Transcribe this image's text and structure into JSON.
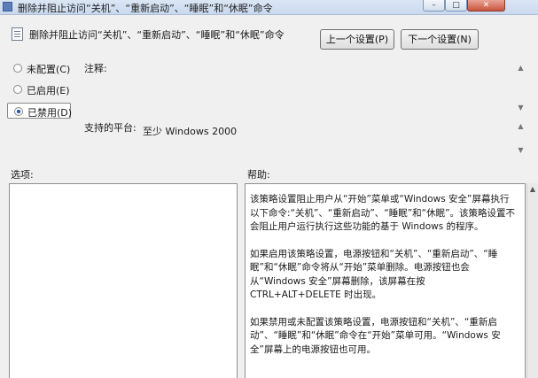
{
  "window": {
    "title": "删除并阻止访问“关机”、“重新启动”、“睡眠”和“休眠”命令",
    "min_glyph": "–",
    "max_glyph": "□",
    "close_glyph": "✕"
  },
  "header": {
    "policy_name": "删除并阻止访问“关机”、“重新启动”、“睡眠”和“休眠”命令",
    "prev_button": "上一个设置(P)",
    "next_button": "下一个设置(N)"
  },
  "options": {
    "radios": [
      {
        "label": "未配置(C)",
        "selected": false
      },
      {
        "label": "已启用(E)",
        "selected": false
      },
      {
        "label": "已禁用(D)",
        "selected": true
      }
    ]
  },
  "labels": {
    "comment": "注释:",
    "platform": "支持的平台:",
    "options": "选项:",
    "help": "帮助:"
  },
  "platform": {
    "value": "至少 Windows 2000"
  },
  "help": {
    "paragraphs": [
      "该策略设置阻止用户从“开始”菜单或“Windows 安全”屏幕执行以下命令:“关机”、“重新启动”、“睡眠”和“休眠”。该策略设置不会阻止用户运行执行这些功能的基于 Windows 的程序。",
      "如果启用该策略设置，电源按钮和“关机”、“重新启动”、“睡眠”和“休眠”命令将从“开始”菜单删除。电源按钮也会从“Windows 安全”屏幕删除，该屏幕在按 CTRL+ALT+DELETE 时出现。",
      "如果禁用或未配置该策略设置，电源按钮和“关机”、“重新启动”、“睡眠”和“休眠”命令在“开始”菜单可用。“Windows 安全”屏幕上的电源按钮也可用。"
    ]
  }
}
